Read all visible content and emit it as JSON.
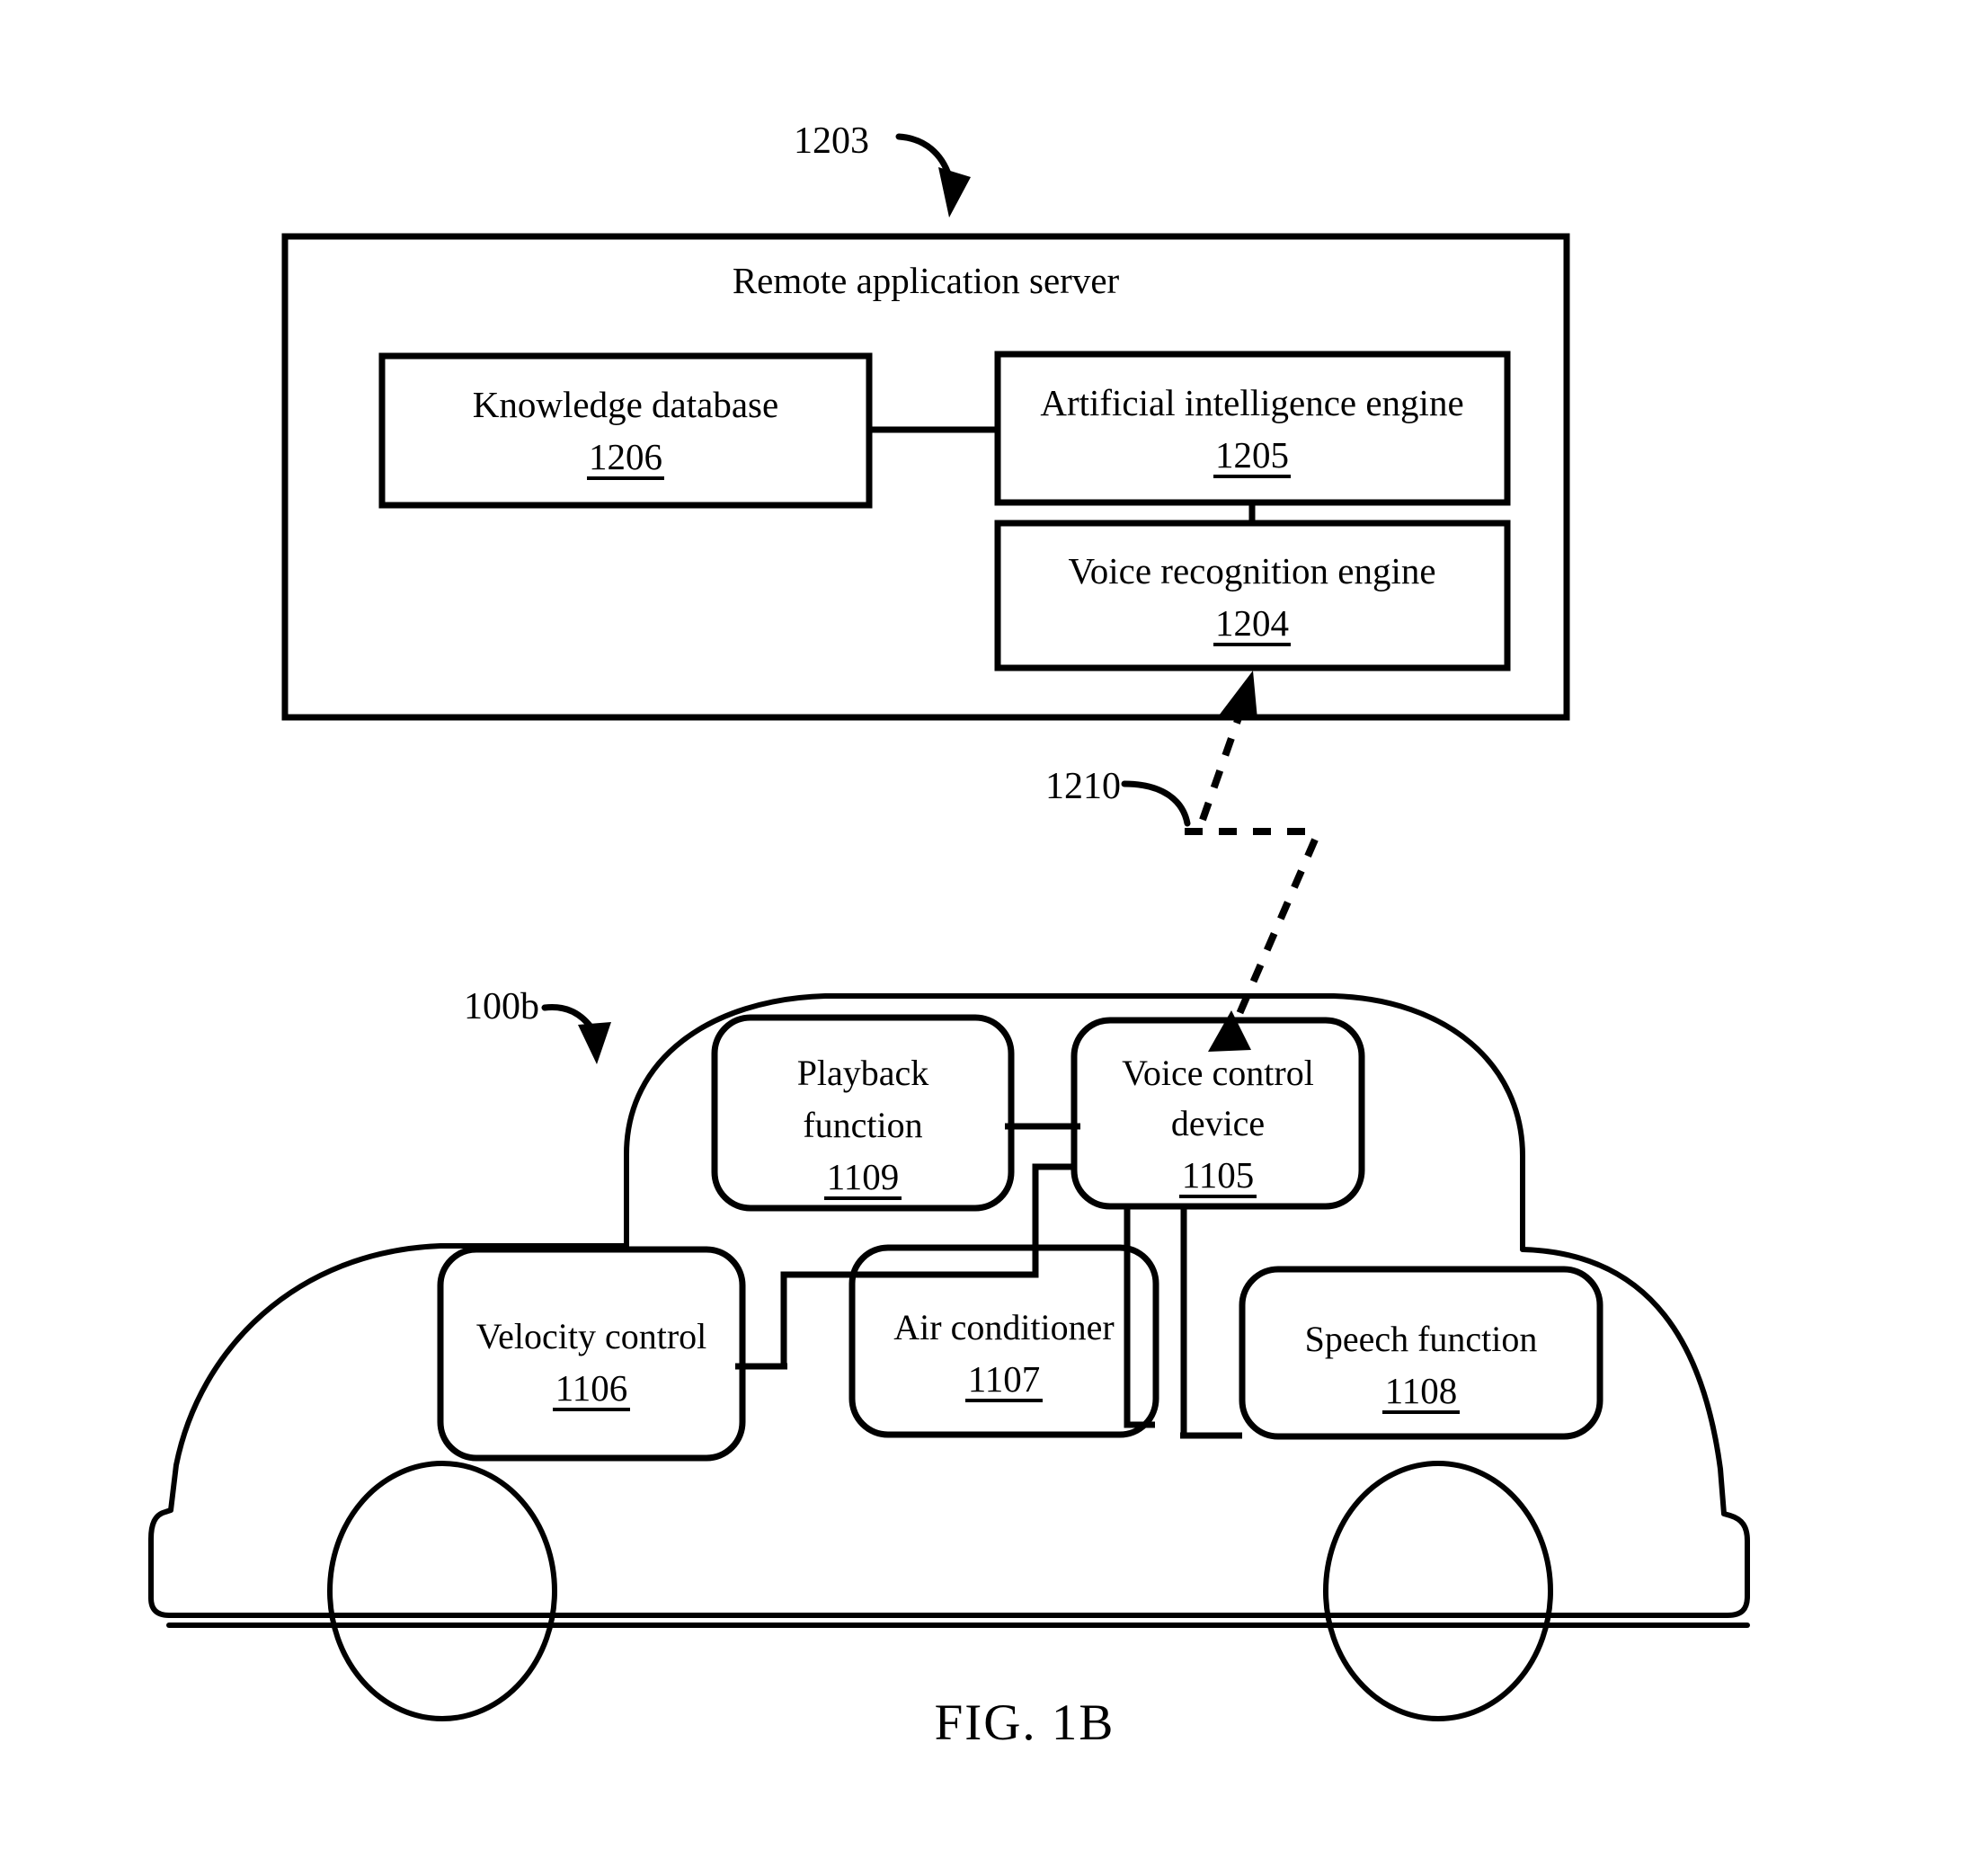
{
  "figure": {
    "caption": "FIG. 1B"
  },
  "server": {
    "ref": "1203",
    "title": "Remote application server",
    "blocks": [
      {
        "id": "knowledge-database",
        "label": "Knowledge database",
        "ref": "1206"
      },
      {
        "id": "ai-engine",
        "label": "Artificial intelligence engine",
        "ref": "1205"
      },
      {
        "id": "voice-recognition-engine",
        "label": "Voice recognition engine",
        "ref": "1204"
      }
    ]
  },
  "link": {
    "ref": "1210",
    "style": "dashed-bidirectional"
  },
  "vehicle": {
    "ref": "100b",
    "blocks": [
      {
        "id": "playback-function",
        "line1": "Playback",
        "line2": "function",
        "ref": "1109"
      },
      {
        "id": "voice-control-device",
        "line1": "Voice control",
        "line2": "device",
        "ref": "1105"
      },
      {
        "id": "velocity-control",
        "line1": "Velocity control",
        "line2": "",
        "ref": "1106"
      },
      {
        "id": "air-conditioner",
        "line1": "Air conditioner",
        "line2": "",
        "ref": "1107"
      },
      {
        "id": "speech-function",
        "line1": "Speech function",
        "line2": "",
        "ref": "1108"
      }
    ]
  },
  "colors": {
    "ink": "#000000",
    "paper": "#ffffff"
  }
}
